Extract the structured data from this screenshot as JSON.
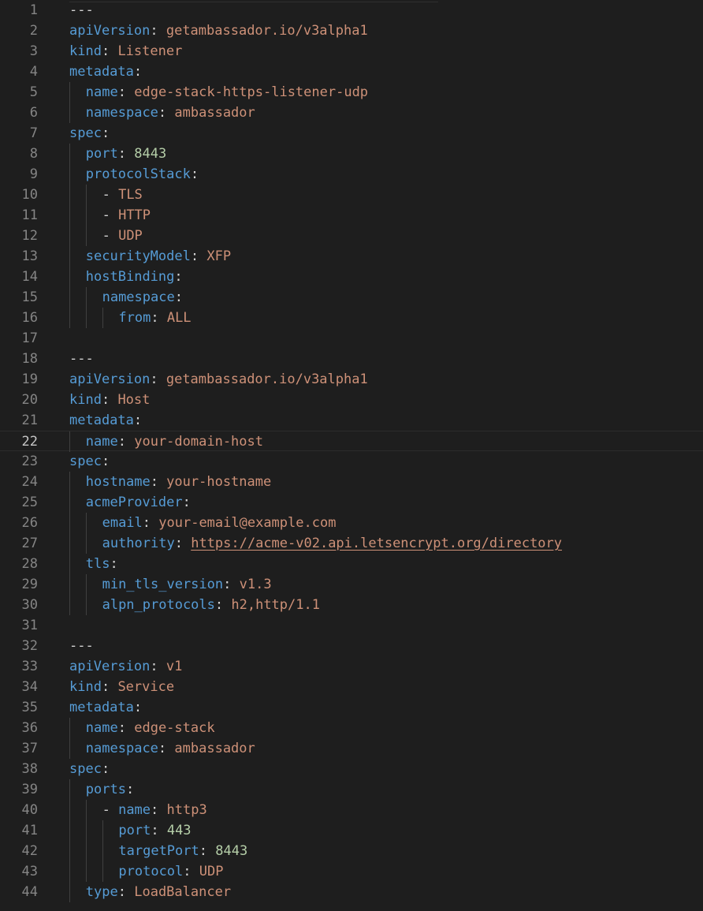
{
  "editor": {
    "language": "yaml",
    "current_line": 22,
    "colors": {
      "background": "#1e1e1e",
      "line_number": "#858585",
      "line_number_active": "#c6c6c6",
      "key": "#569cd6",
      "string": "#ce9178",
      "number": "#b5cea8",
      "punctuation": "#d4d4d4",
      "indent_guide": "#404040"
    },
    "lines": [
      {
        "n": "1",
        "indent": 0,
        "tokens": [
          {
            "t": "---",
            "c": "dash"
          }
        ]
      },
      {
        "n": "2",
        "indent": 0,
        "tokens": [
          {
            "t": "apiVersion",
            "c": "key"
          },
          {
            "t": ": ",
            "c": "punc"
          },
          {
            "t": "getambassador.io/v3alpha1",
            "c": "str"
          }
        ]
      },
      {
        "n": "3",
        "indent": 0,
        "tokens": [
          {
            "t": "kind",
            "c": "key"
          },
          {
            "t": ": ",
            "c": "punc"
          },
          {
            "t": "Listener",
            "c": "str"
          }
        ]
      },
      {
        "n": "4",
        "indent": 0,
        "tokens": [
          {
            "t": "metadata",
            "c": "key"
          },
          {
            "t": ":",
            "c": "punc"
          }
        ]
      },
      {
        "n": "5",
        "indent": 1,
        "tokens": [
          {
            "t": "name",
            "c": "key"
          },
          {
            "t": ": ",
            "c": "punc"
          },
          {
            "t": "edge-stack-https-listener-udp",
            "c": "str"
          }
        ]
      },
      {
        "n": "6",
        "indent": 1,
        "tokens": [
          {
            "t": "namespace",
            "c": "key"
          },
          {
            "t": ": ",
            "c": "punc"
          },
          {
            "t": "ambassador",
            "c": "str"
          }
        ]
      },
      {
        "n": "7",
        "indent": 0,
        "tokens": [
          {
            "t": "spec",
            "c": "key"
          },
          {
            "t": ":",
            "c": "punc"
          }
        ]
      },
      {
        "n": "8",
        "indent": 1,
        "tokens": [
          {
            "t": "port",
            "c": "key"
          },
          {
            "t": ": ",
            "c": "punc"
          },
          {
            "t": "8443",
            "c": "num"
          }
        ]
      },
      {
        "n": "9",
        "indent": 1,
        "tokens": [
          {
            "t": "protocolStack",
            "c": "key"
          },
          {
            "t": ":",
            "c": "punc"
          }
        ]
      },
      {
        "n": "10",
        "indent": 2,
        "tokens": [
          {
            "t": "- ",
            "c": "dash"
          },
          {
            "t": "TLS",
            "c": "str"
          }
        ]
      },
      {
        "n": "11",
        "indent": 2,
        "tokens": [
          {
            "t": "- ",
            "c": "dash"
          },
          {
            "t": "HTTP",
            "c": "str"
          }
        ]
      },
      {
        "n": "12",
        "indent": 2,
        "tokens": [
          {
            "t": "- ",
            "c": "dash"
          },
          {
            "t": "UDP",
            "c": "str"
          }
        ]
      },
      {
        "n": "13",
        "indent": 1,
        "tokens": [
          {
            "t": "securityModel",
            "c": "key"
          },
          {
            "t": ": ",
            "c": "punc"
          },
          {
            "t": "XFP",
            "c": "str"
          }
        ]
      },
      {
        "n": "14",
        "indent": 1,
        "tokens": [
          {
            "t": "hostBinding",
            "c": "key"
          },
          {
            "t": ":",
            "c": "punc"
          }
        ]
      },
      {
        "n": "15",
        "indent": 2,
        "tokens": [
          {
            "t": "namespace",
            "c": "key"
          },
          {
            "t": ":",
            "c": "punc"
          }
        ]
      },
      {
        "n": "16",
        "indent": 3,
        "tokens": [
          {
            "t": "from",
            "c": "key"
          },
          {
            "t": ": ",
            "c": "punc"
          },
          {
            "t": "ALL",
            "c": "str"
          }
        ]
      },
      {
        "n": "17",
        "indent": 0,
        "tokens": []
      },
      {
        "n": "18",
        "indent": 0,
        "tokens": [
          {
            "t": "---",
            "c": "dash"
          }
        ]
      },
      {
        "n": "19",
        "indent": 0,
        "tokens": [
          {
            "t": "apiVersion",
            "c": "key"
          },
          {
            "t": ": ",
            "c": "punc"
          },
          {
            "t": "getambassador.io/v3alpha1",
            "c": "str"
          }
        ]
      },
      {
        "n": "20",
        "indent": 0,
        "tokens": [
          {
            "t": "kind",
            "c": "key"
          },
          {
            "t": ": ",
            "c": "punc"
          },
          {
            "t": "Host",
            "c": "str"
          }
        ]
      },
      {
        "n": "21",
        "indent": 0,
        "tokens": [
          {
            "t": "metadata",
            "c": "key"
          },
          {
            "t": ":",
            "c": "punc"
          }
        ]
      },
      {
        "n": "22",
        "indent": 1,
        "tokens": [
          {
            "t": "name",
            "c": "key"
          },
          {
            "t": ": ",
            "c": "punc"
          },
          {
            "t": "your-domain-host",
            "c": "str"
          }
        ]
      },
      {
        "n": "23",
        "indent": 0,
        "tokens": [
          {
            "t": "spec",
            "c": "key"
          },
          {
            "t": ":",
            "c": "punc"
          }
        ]
      },
      {
        "n": "24",
        "indent": 1,
        "tokens": [
          {
            "t": "hostname",
            "c": "key"
          },
          {
            "t": ": ",
            "c": "punc"
          },
          {
            "t": "your-hostname",
            "c": "str"
          }
        ]
      },
      {
        "n": "25",
        "indent": 1,
        "tokens": [
          {
            "t": "acmeProvider",
            "c": "key"
          },
          {
            "t": ":",
            "c": "punc"
          }
        ]
      },
      {
        "n": "26",
        "indent": 2,
        "tokens": [
          {
            "t": "email",
            "c": "key"
          },
          {
            "t": ": ",
            "c": "punc"
          },
          {
            "t": "your-email@example.com",
            "c": "str"
          }
        ]
      },
      {
        "n": "27",
        "indent": 2,
        "tokens": [
          {
            "t": "authority",
            "c": "key"
          },
          {
            "t": ": ",
            "c": "punc"
          },
          {
            "t": "https://acme-v02.api.letsencrypt.org/directory",
            "c": "link"
          }
        ]
      },
      {
        "n": "28",
        "indent": 1,
        "tokens": [
          {
            "t": "tls",
            "c": "key"
          },
          {
            "t": ":",
            "c": "punc"
          }
        ]
      },
      {
        "n": "29",
        "indent": 2,
        "tokens": [
          {
            "t": "min_tls_version",
            "c": "key"
          },
          {
            "t": ": ",
            "c": "punc"
          },
          {
            "t": "v1.3",
            "c": "str"
          }
        ]
      },
      {
        "n": "30",
        "indent": 2,
        "tokens": [
          {
            "t": "alpn_protocols",
            "c": "key"
          },
          {
            "t": ": ",
            "c": "punc"
          },
          {
            "t": "h2,http/1.1",
            "c": "str"
          }
        ]
      },
      {
        "n": "31",
        "indent": 0,
        "tokens": []
      },
      {
        "n": "32",
        "indent": 0,
        "tokens": [
          {
            "t": "---",
            "c": "dash"
          }
        ]
      },
      {
        "n": "33",
        "indent": 0,
        "tokens": [
          {
            "t": "apiVersion",
            "c": "key"
          },
          {
            "t": ": ",
            "c": "punc"
          },
          {
            "t": "v1",
            "c": "str"
          }
        ]
      },
      {
        "n": "34",
        "indent": 0,
        "tokens": [
          {
            "t": "kind",
            "c": "key"
          },
          {
            "t": ": ",
            "c": "punc"
          },
          {
            "t": "Service",
            "c": "str"
          }
        ]
      },
      {
        "n": "35",
        "indent": 0,
        "tokens": [
          {
            "t": "metadata",
            "c": "key"
          },
          {
            "t": ":",
            "c": "punc"
          }
        ]
      },
      {
        "n": "36",
        "indent": 1,
        "tokens": [
          {
            "t": "name",
            "c": "key"
          },
          {
            "t": ": ",
            "c": "punc"
          },
          {
            "t": "edge-stack",
            "c": "str"
          }
        ]
      },
      {
        "n": "37",
        "indent": 1,
        "tokens": [
          {
            "t": "namespace",
            "c": "key"
          },
          {
            "t": ": ",
            "c": "punc"
          },
          {
            "t": "ambassador",
            "c": "str"
          }
        ]
      },
      {
        "n": "38",
        "indent": 0,
        "tokens": [
          {
            "t": "spec",
            "c": "key"
          },
          {
            "t": ":",
            "c": "punc"
          }
        ]
      },
      {
        "n": "39",
        "indent": 1,
        "tokens": [
          {
            "t": "ports",
            "c": "key"
          },
          {
            "t": ":",
            "c": "punc"
          }
        ]
      },
      {
        "n": "40",
        "indent": 2,
        "tokens": [
          {
            "t": "- ",
            "c": "dash"
          },
          {
            "t": "name",
            "c": "key"
          },
          {
            "t": ": ",
            "c": "punc"
          },
          {
            "t": "http3",
            "c": "str"
          }
        ]
      },
      {
        "n": "41",
        "indent": 3,
        "tokens": [
          {
            "t": "port",
            "c": "key"
          },
          {
            "t": ": ",
            "c": "punc"
          },
          {
            "t": "443",
            "c": "num"
          }
        ]
      },
      {
        "n": "42",
        "indent": 3,
        "tokens": [
          {
            "t": "targetPort",
            "c": "key"
          },
          {
            "t": ": ",
            "c": "punc"
          },
          {
            "t": "8443",
            "c": "num"
          }
        ]
      },
      {
        "n": "43",
        "indent": 3,
        "tokens": [
          {
            "t": "protocol",
            "c": "key"
          },
          {
            "t": ": ",
            "c": "punc"
          },
          {
            "t": "UDP",
            "c": "str"
          }
        ]
      },
      {
        "n": "44",
        "indent": 1,
        "tokens": [
          {
            "t": "type",
            "c": "key"
          },
          {
            "t": ": ",
            "c": "punc"
          },
          {
            "t": "LoadBalancer",
            "c": "str"
          }
        ]
      }
    ]
  }
}
